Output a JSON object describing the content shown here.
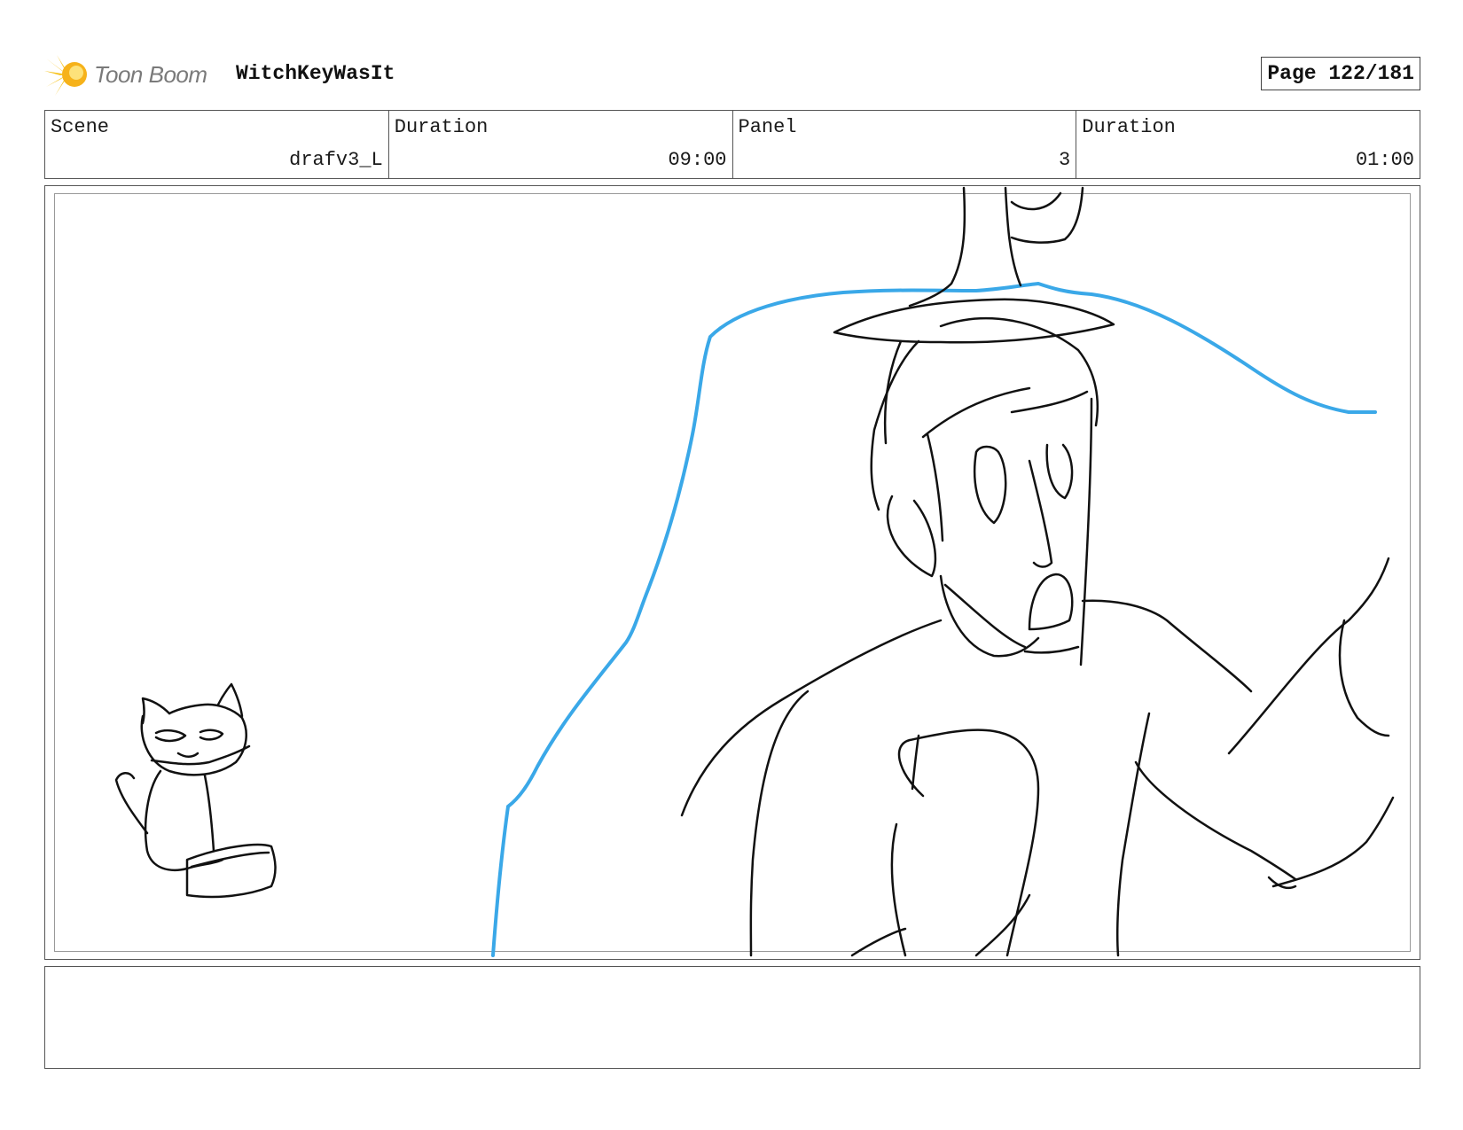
{
  "header": {
    "logo_text": "Toon Boom",
    "project_name": "WitchKeyWasIt",
    "page_label": "Page 122/181"
  },
  "info": {
    "scene_label": "Scene",
    "scene_value": "drafv3_L",
    "scene_duration_label": "Duration",
    "scene_duration_value": "09:00",
    "panel_label": "Panel",
    "panel_value": "3",
    "panel_duration_label": "Duration",
    "panel_duration_value": "01:00"
  },
  "notes": {
    "text": ""
  },
  "colors": {
    "accent_blue": "#3aa8e8",
    "logo_yellow": "#f6c21a",
    "line": "#111111"
  }
}
